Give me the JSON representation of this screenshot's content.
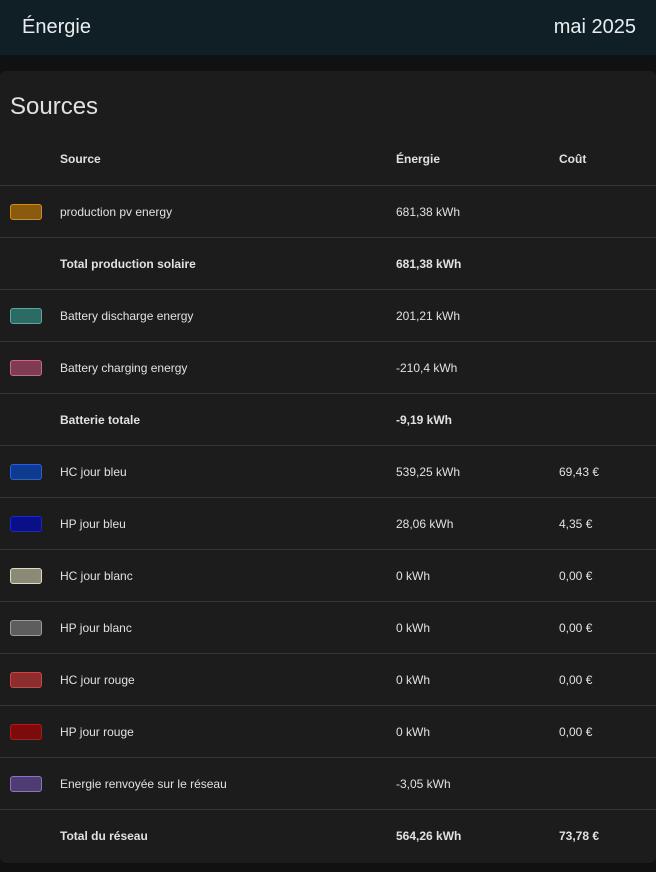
{
  "header": {
    "title": "Énergie",
    "period": "mai 2025"
  },
  "card": {
    "title": "Sources",
    "columns": {
      "source": "Source",
      "energy": "Énergie",
      "cost": "Coût"
    },
    "rows": [
      {
        "source": "production pv energy",
        "energy": "681,38 kWh",
        "cost": "",
        "swatch": "#8a5a0f",
        "border": "#d08d1f",
        "total": false
      },
      {
        "source": "Total production solaire",
        "energy": "681,38 kWh",
        "cost": "",
        "swatch": "",
        "border": "",
        "total": true
      },
      {
        "source": "Battery discharge energy",
        "energy": "201,21 kWh",
        "cost": "",
        "swatch": "#2b6a65",
        "border": "#5fa79e",
        "total": false
      },
      {
        "source": "Battery charging energy",
        "energy": "-210,4 kWh",
        "cost": "",
        "swatch": "#7e3b53",
        "border": "#c96a8c",
        "total": false
      },
      {
        "source": "Batterie totale",
        "energy": "-9,19 kWh",
        "cost": "",
        "swatch": "",
        "border": "",
        "total": true
      },
      {
        "source": "HC jour bleu",
        "energy": "539,25 kWh",
        "cost": "69,43 €",
        "swatch": "#0e3a8f",
        "border": "#2a5fd6",
        "total": false
      },
      {
        "source": "HP jour bleu",
        "energy": "28,06 kWh",
        "cost": "4,35 €",
        "swatch": "#090f86",
        "border": "#1d27c4",
        "total": false
      },
      {
        "source": "HC jour blanc",
        "energy": "0 kWh",
        "cost": "0,00 €",
        "swatch": "#8b8a77",
        "border": "#dddbc6",
        "total": false
      },
      {
        "source": "HP jour blanc",
        "energy": "0 kWh",
        "cost": "0,00 €",
        "swatch": "#5d5d5d",
        "border": "#9a9a9a",
        "total": false
      },
      {
        "source": "HC jour rouge",
        "energy": "0 kWh",
        "cost": "0,00 €",
        "swatch": "#8d2d2d",
        "border": "#c84848",
        "total": false
      },
      {
        "source": "HP jour rouge",
        "energy": "0 kWh",
        "cost": "0,00 €",
        "swatch": "#7c0c0c",
        "border": "#b51818",
        "total": false
      },
      {
        "source": "Energie renvoyée sur le réseau",
        "energy": "-3,05 kWh",
        "cost": "",
        "swatch": "#4e3d72",
        "border": "#8e74bd",
        "total": false
      },
      {
        "source": "Total du réseau",
        "energy": "564,26 kWh",
        "cost": "73,78 €",
        "swatch": "",
        "border": "",
        "total": true
      }
    ]
  }
}
